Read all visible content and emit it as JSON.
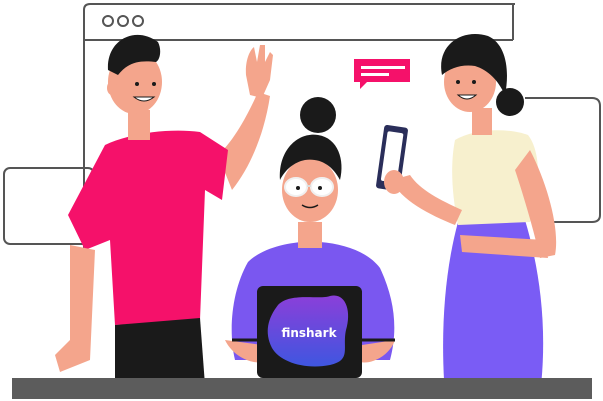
{
  "laptop": {
    "brand": "finshark",
    "logo_color_top": "#8B3FD9",
    "logo_color_bottom": "#3F56E0"
  },
  "colors": {
    "outline": "#555555",
    "pink_shirt": "#F5116A",
    "purple_top": "#7A57F0",
    "cream_top": "#F7F0CE",
    "purple_skirt": "#7A5CF5",
    "skin": "#F4A58C",
    "hair": "#1A1A1A",
    "desk": "#5C5C5C",
    "chat_bubble": "#F5116A"
  },
  "icons": [
    "browser-window-icon",
    "chat-bubble-icon",
    "smartphone-icon"
  ]
}
